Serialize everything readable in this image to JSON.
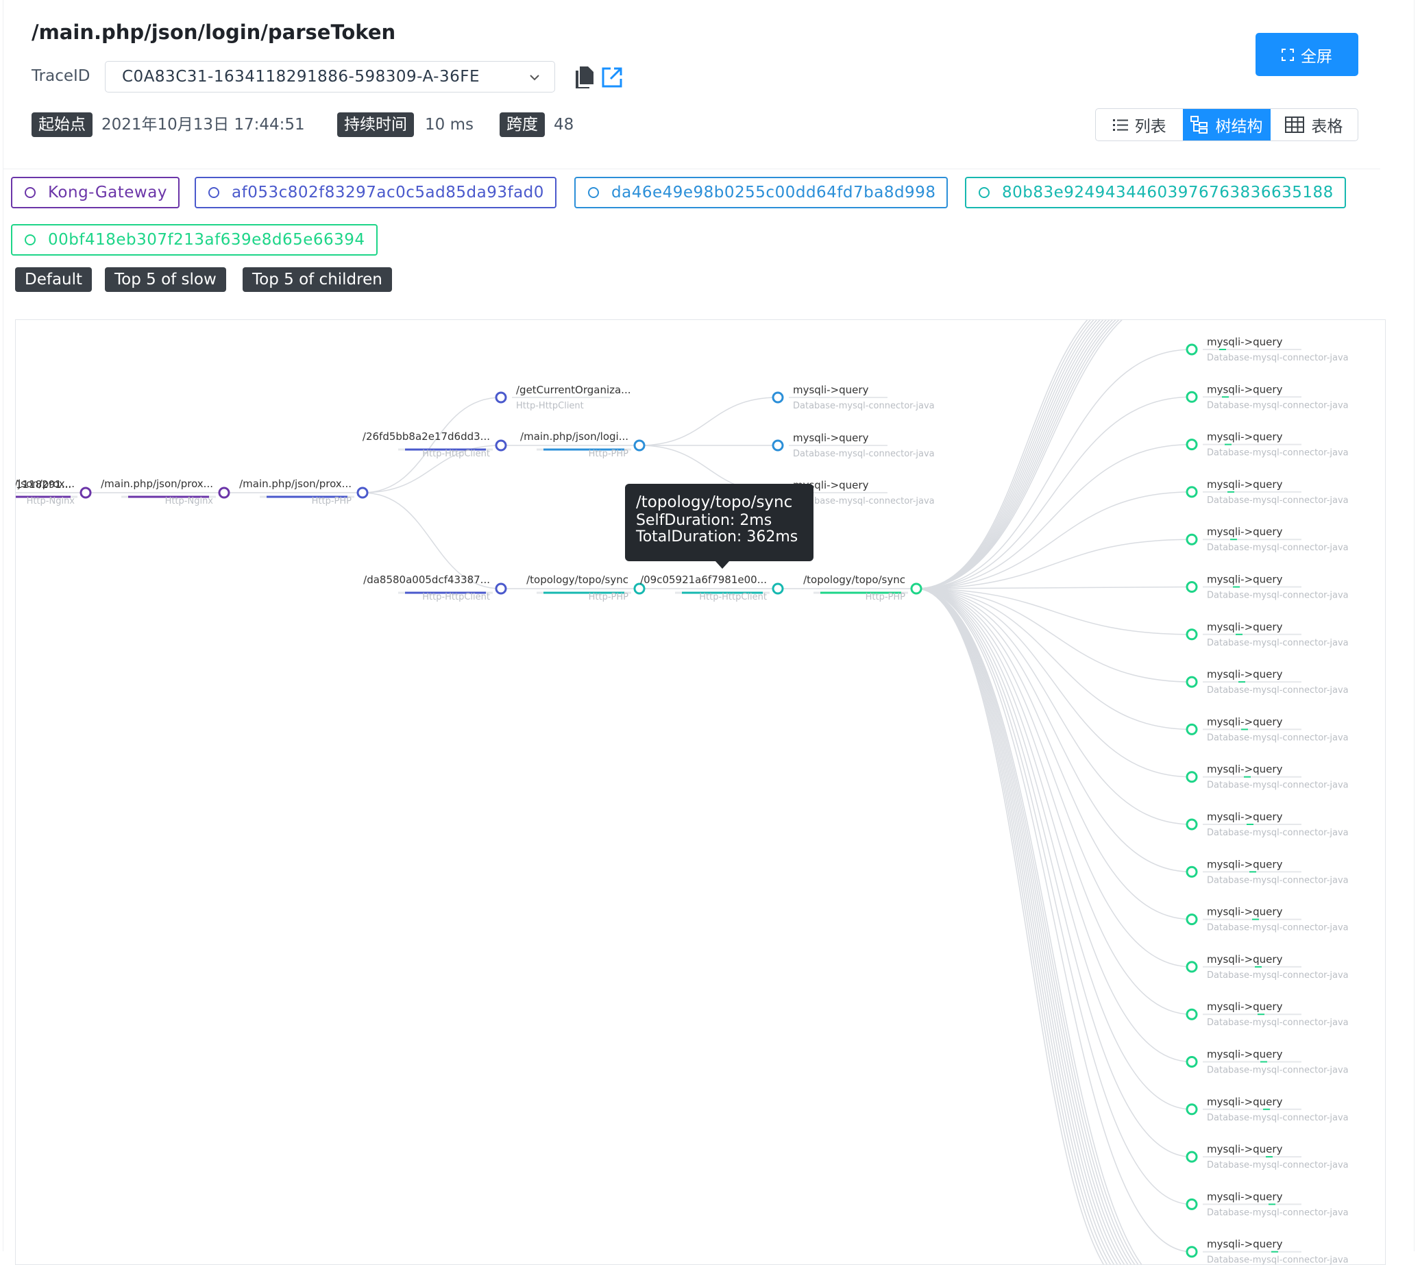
{
  "header": {
    "title": "/main.php/json/login/parseToken",
    "trace_label": "TraceID",
    "trace_value": "C0A83C31-1634118291886-598309-A-36FE",
    "copy_icon": "copy-icon",
    "open_icon": "external-link-icon",
    "meta": [
      {
        "badge": "起始点",
        "value": "2021年10月13日 17:44:51"
      },
      {
        "badge": "持续时间",
        "value": "10 ms"
      },
      {
        "badge": "跨度",
        "value": "48"
      }
    ],
    "fullscreen_label": "全屏",
    "views": [
      {
        "label": "列表",
        "icon": "list-icon",
        "active": false
      },
      {
        "label": "树结构",
        "icon": "tree-icon",
        "active": true
      },
      {
        "label": "表格",
        "icon": "table-icon",
        "active": false
      }
    ]
  },
  "services": [
    {
      "label": "Kong-Gateway",
      "color": "#6b35a8"
    },
    {
      "label": "af053c802f83297ac0c5ad85da93fad0",
      "color": "#4a59cc"
    },
    {
      "label": "da46e49e98b0255c00dd64fd7ba8d998",
      "color": "#2b8fd8"
    },
    {
      "label": "80b83e92494344603976763836635188",
      "color": "#16b8b0"
    },
    {
      "label": "00bf418eb307f213af639e8d65e66394",
      "color": "#1dd588"
    }
  ],
  "modes": [
    "Default",
    "Top 5 of slow",
    "Top 5 of children"
  ],
  "tree": {
    "root_label": "...1118291...",
    "nodes": [
      {
        "id": "n1",
        "label": "/main.php/json/prox...",
        "type": "Http-Nginx",
        "color": "#6b35a8"
      },
      {
        "id": "n2",
        "label": "/main.php/json/prox...",
        "type": "Http-Nginx",
        "color": "#6b35a8"
      },
      {
        "id": "n3",
        "label": "/main.php/json/prox...",
        "type": "Http-PHP",
        "color": "#4a59cc"
      },
      {
        "id": "n4",
        "label": "/getCurrentOrganiza...",
        "type": "Http-HttpClient",
        "color": "#4a59cc"
      },
      {
        "id": "n5",
        "label": "/26fd5bb8a2e17d6dd3...",
        "type": "Http-HttpClient",
        "color": "#4a59cc"
      },
      {
        "id": "n6",
        "label": "/main.php/json/logi...",
        "type": "Http-PHP",
        "color": "#2b8fd8"
      },
      {
        "id": "n7",
        "label": "mysqli->query",
        "type": "Database-mysql-connector-java",
        "color": "#2b8fd8"
      },
      {
        "id": "n8",
        "label": "mysqli->query",
        "type": "Database-mysql-connector-java",
        "color": "#2b8fd8"
      },
      {
        "id": "n9",
        "label": "mysqli->query",
        "type": "Database-mysql-connector-java",
        "color": "#2b8fd8"
      },
      {
        "id": "n10",
        "label": "/da8580a005dcf43387...",
        "type": "Http-HttpClient",
        "color": "#4a59cc"
      },
      {
        "id": "n11",
        "label": "/topology/topo/sync",
        "type": "Http-PHP",
        "color": "#16b8b0"
      },
      {
        "id": "n12",
        "label": "/09c05921a6f7981e00...",
        "type": "Http-HttpClient",
        "color": "#16b8b0"
      },
      {
        "id": "n13",
        "label": "/topology/topo/sync",
        "type": "Http-PHP",
        "color": "#1dd588"
      }
    ],
    "leaf_label": "mysqli->query",
    "leaf_type": "Database-mysql-connector-java",
    "leaf_count": 20
  },
  "tooltip": {
    "title": "/topology/topo/sync",
    "self": "SelfDuration: 2ms",
    "total": "TotalDuration: 362ms"
  }
}
